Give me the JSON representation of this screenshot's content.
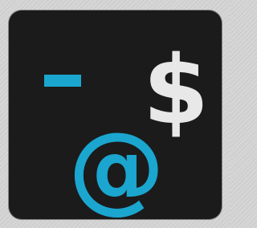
{
  "app_icon": {
    "dash_glyph": "−",
    "dollar_glyph": "$",
    "at_glyph": "@"
  },
  "colors": {
    "accent": "#1aa6cf",
    "foreground": "#e8e8e8",
    "icon_background": "#1b1b1c",
    "page_background": "#d4d4d4"
  }
}
